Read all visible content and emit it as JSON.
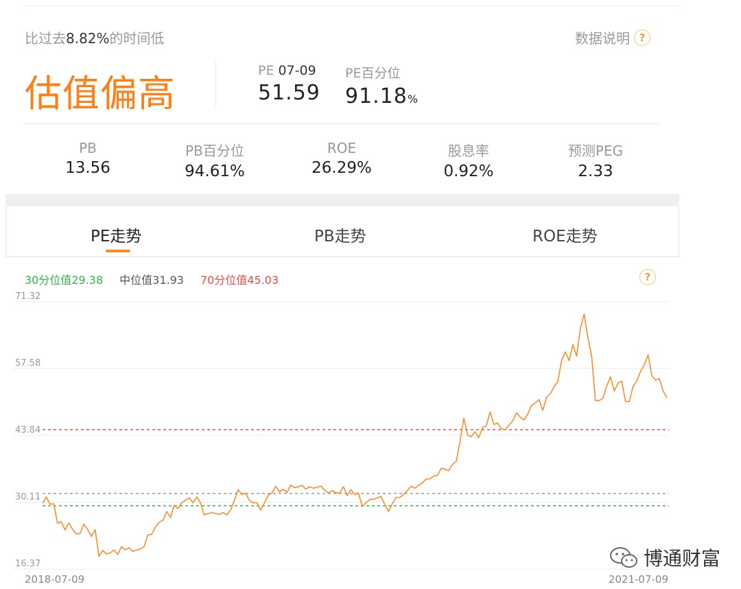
{
  "summary": {
    "compare_prefix": "比过去",
    "compare_pct": "8.82%",
    "compare_suffix": "的时间低",
    "explain_label": "数据说明",
    "help_glyph": "?",
    "status": "估值偏高"
  },
  "pe": {
    "label": "PE",
    "date": "07-09",
    "value": "51.59",
    "pct_label": "PE百分位",
    "pct_value": "91.18",
    "pct_unit": "%"
  },
  "metrics": [
    {
      "label": "PB",
      "value": "13.56"
    },
    {
      "label": "PB百分位",
      "value": "94.61%"
    },
    {
      "label": "ROE",
      "value": "26.29%"
    },
    {
      "label": "股息率",
      "value": "0.92%"
    },
    {
      "label": "预测PEG",
      "value": "2.33"
    }
  ],
  "tabs": [
    {
      "label": "PE走势",
      "active": true
    },
    {
      "label": "PB走势",
      "active": false
    },
    {
      "label": "ROE走势",
      "active": false
    }
  ],
  "legend": {
    "p30": "30分位值29.38",
    "median": "中位值31.93",
    "p70": "70分位值45.03"
  },
  "colors": {
    "accent": "#ff7f14",
    "line": "#ff8c2a",
    "p30": "#33b24a",
    "median": "#999999",
    "p70": "#e84a4a"
  },
  "watermark": {
    "icon": "wechat-icon",
    "text": "博通财富"
  },
  "chart_data": {
    "type": "line",
    "x_start": "2018-07-09",
    "x_end": "2021-07-09",
    "y_ticks": [
      71.32,
      57.58,
      43.84,
      30.11,
      16.37
    ],
    "ylim": [
      16.37,
      71.32
    ],
    "reference_lines": [
      {
        "name": "30分位值",
        "value": 29.38
      },
      {
        "name": "中位值",
        "value": 31.93
      },
      {
        "name": "70分位值",
        "value": 45.03
      }
    ],
    "series": [
      {
        "values": [
          29.9,
          31.2,
          29.7,
          29.8,
          25.8,
          26.1,
          24.4,
          25.9,
          24.5,
          23.6,
          23.7,
          25.6,
          24.5,
          23.1,
          24.5,
          19.0,
          20.2,
          19.5,
          19.7,
          20.3,
          19.4,
          21.0,
          20.3,
          20.8,
          20.0,
          20.3,
          20.5,
          21.0,
          23.4,
          23.5,
          25.0,
          26.0,
          26.4,
          28.2,
          27.0,
          29.5,
          28.8,
          30.0,
          30.5,
          31.0,
          30.0,
          31.2,
          30.0,
          27.5,
          27.8,
          28.0,
          27.8,
          27.6,
          28.0,
          27.5,
          28.5,
          30.5,
          32.7,
          31.7,
          32.0,
          30.5,
          30.0,
          30.0,
          28.5,
          30.0,
          31.5,
          32.0,
          33.4,
          32.2,
          32.8,
          32.1,
          33.6,
          33.1,
          33.3,
          33.6,
          32.8,
          33.3,
          33.0,
          33.2,
          33.4,
          32.6,
          32.0,
          32.5,
          32.1,
          32.0,
          33.3,
          31.5,
          32.7,
          31.7,
          32.0,
          29.2,
          30.0,
          30.7,
          30.7,
          31.0,
          31.3,
          29.6,
          28.2,
          29.8,
          31.1,
          31.1,
          31.7,
          32.5,
          33.4,
          33.0,
          33.6,
          34.1,
          34.9,
          34.9,
          35.5,
          35.6,
          37.1,
          36.9,
          36.6,
          37.9,
          38.5,
          42.6,
          47.4,
          43.9,
          43.6,
          44.6,
          43.4,
          45.5,
          45.8,
          48.7,
          46.1,
          46.4,
          45.2,
          45.0,
          46.0,
          46.8,
          48.5,
          47.6,
          47.0,
          48.2,
          50.0,
          50.5,
          51.2,
          49.0,
          51.7,
          52.4,
          53.8,
          54.9,
          59.2,
          61.0,
          59.2,
          62.5,
          60.1,
          65.8,
          68.8,
          64.0,
          60.0,
          51.0,
          51.0,
          51.5,
          54.0,
          55.9,
          53.0,
          54.6,
          55.0,
          50.8,
          50.8,
          53.9,
          55.0,
          57.0,
          58.4,
          60.4,
          56.1,
          55.2,
          55.5,
          53.0,
          51.6
        ]
      }
    ],
    "grid": true,
    "legend_position": "top-left"
  }
}
